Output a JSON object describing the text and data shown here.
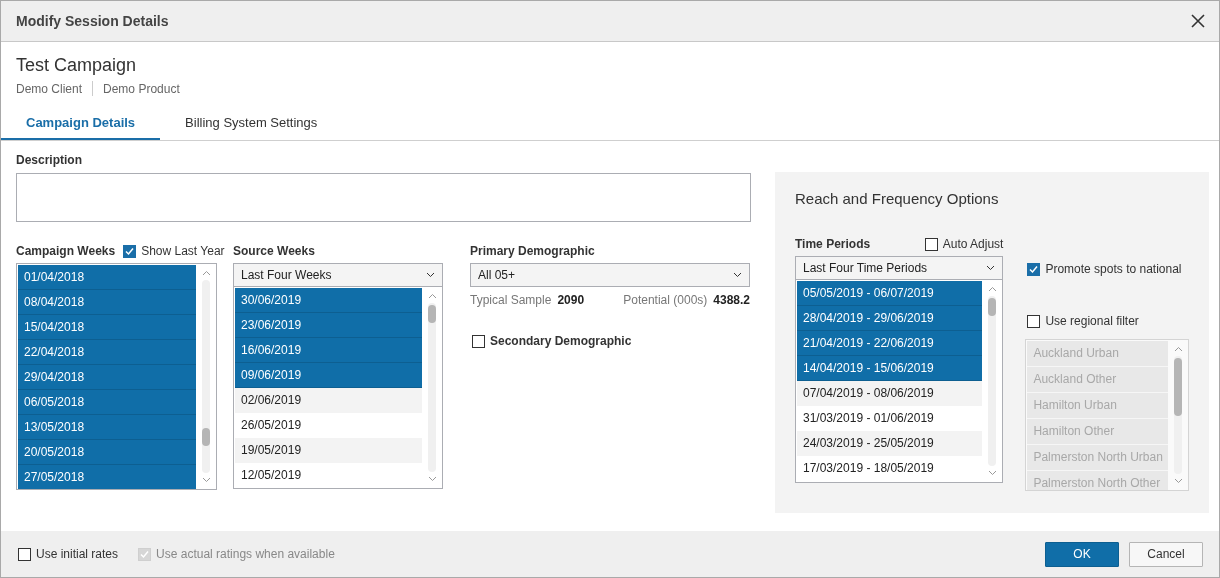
{
  "window": {
    "title": "Modify Session Details"
  },
  "header": {
    "title": "Test Campaign",
    "client": "Demo Client",
    "product": "Demo Product"
  },
  "tabs": [
    {
      "label": "Campaign Details",
      "selected": true
    },
    {
      "label": "Billing System Settings",
      "selected": false
    }
  ],
  "description": {
    "label": "Description"
  },
  "campaign_weeks": {
    "label": "Campaign Weeks",
    "show_last_year": {
      "label": "Show Last Year",
      "checked": true
    },
    "items": [
      {
        "label": "01/04/2018",
        "selected": true
      },
      {
        "label": "08/04/2018",
        "selected": true
      },
      {
        "label": "15/04/2018",
        "selected": true
      },
      {
        "label": "22/04/2018",
        "selected": true
      },
      {
        "label": "29/04/2018",
        "selected": true
      },
      {
        "label": "06/05/2018",
        "selected": true
      },
      {
        "label": "13/05/2018",
        "selected": true
      },
      {
        "label": "20/05/2018",
        "selected": true
      },
      {
        "label": "27/05/2018",
        "selected": true
      }
    ]
  },
  "source_weeks": {
    "label": "Source Weeks",
    "dropdown": "Last Four Weeks",
    "items": [
      {
        "label": "30/06/2019",
        "selected": true
      },
      {
        "label": "23/06/2019",
        "selected": true
      },
      {
        "label": "16/06/2019",
        "selected": true
      },
      {
        "label": "09/06/2019",
        "selected": true
      },
      {
        "label": "02/06/2019",
        "selected": false
      },
      {
        "label": "26/05/2019",
        "selected": false
      },
      {
        "label": "19/05/2019",
        "selected": false
      },
      {
        "label": "12/05/2019",
        "selected": false
      }
    ]
  },
  "primary_demographic": {
    "label": "Primary Demographic",
    "dropdown": "All 05+",
    "sample_label": "Typical Sample",
    "sample_value": "2090",
    "potential_label": "Potential (000s)",
    "potential_value": "4388.2"
  },
  "secondary_demographic": {
    "label": "Secondary Demographic",
    "checked": false
  },
  "reach_frequency": {
    "title": "Reach and Frequency Options",
    "time_periods": {
      "label": "Time Periods",
      "auto_adjust": {
        "label": "Auto Adjust",
        "checked": false
      },
      "dropdown": "Last Four Time Periods",
      "items": [
        {
          "label": "05/05/2019 - 06/07/2019",
          "selected": true
        },
        {
          "label": "28/04/2019 - 29/06/2019",
          "selected": true
        },
        {
          "label": "21/04/2019 - 22/06/2019",
          "selected": true
        },
        {
          "label": "14/04/2019 - 15/06/2019",
          "selected": true
        },
        {
          "label": "07/04/2019 - 08/06/2019",
          "selected": false
        },
        {
          "label": "31/03/2019 - 01/06/2019",
          "selected": false
        },
        {
          "label": "24/03/2019 - 25/05/2019",
          "selected": false
        },
        {
          "label": "17/03/2019 - 18/05/2019",
          "selected": false
        }
      ]
    },
    "promote_spots": {
      "label": "Promote spots to national",
      "checked": true
    },
    "regional_filter": {
      "label": "Use regional filter",
      "checked": false
    },
    "regions": {
      "disabled": true,
      "items": [
        "Auckland Urban",
        "Auckland Other",
        "Hamilton Urban",
        "Hamilton Other",
        "Palmerston North Urban",
        "Palmerston North Other"
      ]
    }
  },
  "footer": {
    "use_initial_rates": {
      "label": "Use initial rates",
      "checked": false,
      "disabled": false
    },
    "use_actual_ratings": {
      "label": "Use actual ratings when available",
      "checked": true,
      "disabled": true
    },
    "buttons": [
      {
        "label": "OK",
        "kind": "primary"
      },
      {
        "label": "Cancel",
        "kind": "secondary"
      }
    ]
  }
}
